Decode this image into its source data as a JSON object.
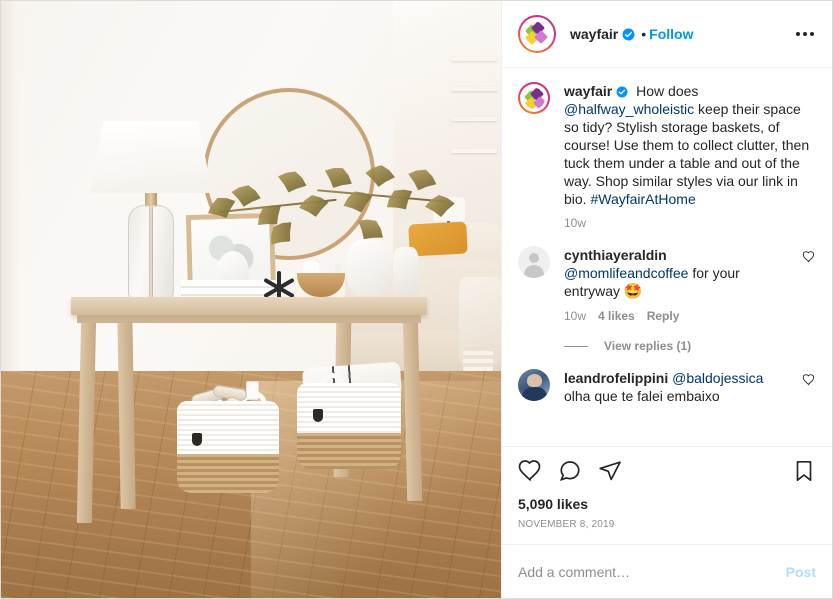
{
  "header": {
    "username": "wayfair",
    "verified_icon": "verified-badge-icon",
    "separator": "•",
    "follow_label": "Follow",
    "more_options_icon": "more-options-icon"
  },
  "caption": {
    "username": "wayfair",
    "mention": "@halfway_wholeistic",
    "text_before_mention": " How does ",
    "text_after_mention": " keep their space so tidy? Stylish storage baskets, of course! Use them to collect clutter, then tuck them under a table and out of the way. Shop similar styles via our link in bio. ",
    "hashtag": "#WayfairAtHome",
    "timestamp": "10w"
  },
  "comments": [
    {
      "username": "cynthiayeraldin",
      "mention": "@momlifeandcoffee",
      "text": " for your entryway ",
      "emoji": "🤩",
      "timestamp": "10w",
      "likes": "4 likes",
      "reply_label": "Reply",
      "avatar_type": "default-avatar"
    },
    {
      "username": "leandrofelippini",
      "mention": "@baldojessica",
      "text": "olha que te falei embaixo",
      "avatar_type": "photo-avatar"
    }
  ],
  "view_replies": {
    "label": "View replies (1)"
  },
  "actions": {
    "like_icon": "heart-icon",
    "comment_icon": "comment-bubble-icon",
    "share_icon": "share-paper-plane-icon",
    "save_icon": "bookmark-icon"
  },
  "likes_count": "5,090 likes",
  "post_date": "NOVEMBER 8, 2019",
  "add_comment": {
    "placeholder": "Add a comment…",
    "value": "",
    "post_label": "Post"
  },
  "photo": {
    "alt": "Entryway with light wood console table, white glass lamp, round gold mirror, autumn foliage, and two white rope storage baskets with jute bottoms on hardwood floor"
  },
  "colors": {
    "accent_blue": "#0095f6",
    "link_blue": "#00376b",
    "post_disabled": "#b2dffc",
    "text_primary": "#262626",
    "text_secondary": "#8e8e8e",
    "border": "#efefef"
  }
}
